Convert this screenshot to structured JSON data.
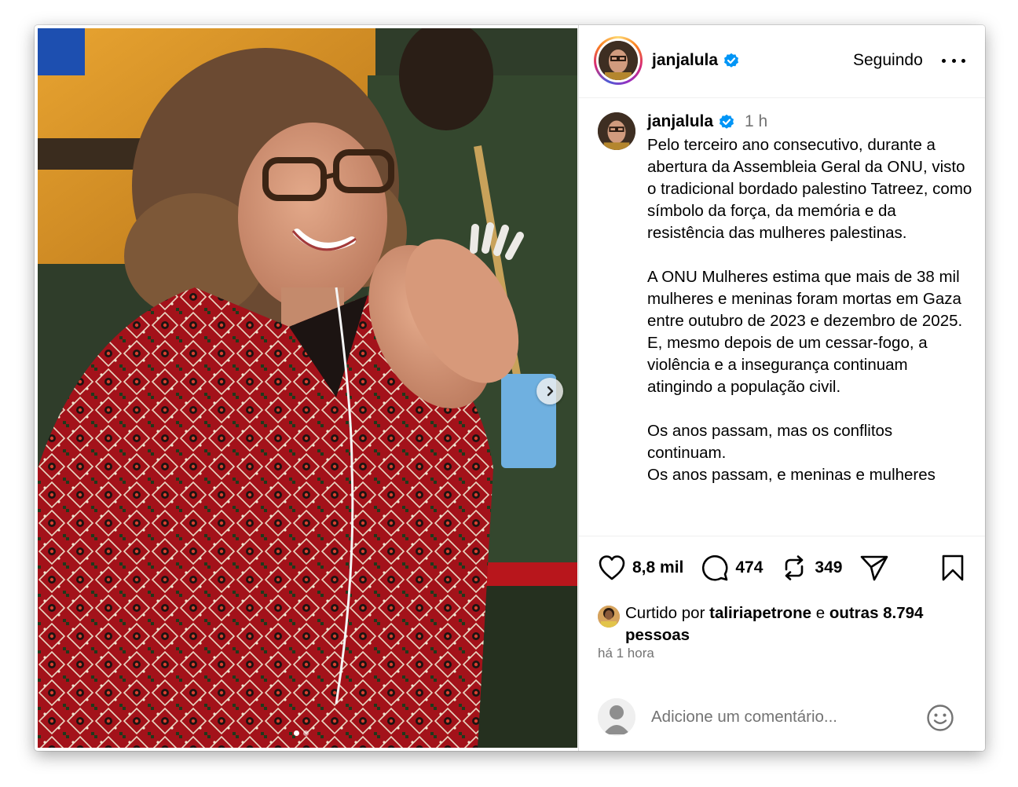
{
  "post": {
    "username": "janjalula",
    "follow_state": "Seguindo",
    "time_short": "1 h",
    "caption": "Pelo terceiro ano consecutivo, durante a abertura da Assembleia Geral da ONU, visto o tradicional bordado palestino Tatreez, como símbolo da força, da memória e da resistência das mulheres palestinas.\n\nA ONU Mulheres estima que mais de 38 mil mulheres e meninas foram mortas em Gaza entre outubro de 2023 e dezembro de 2025. E, mesmo depois de um cessar-fogo, a violência e a insegurança continuam atingindo a população civil.\n\nOs anos passam, mas os conflitos continuam.\nOs anos passam, e meninas e mulheres",
    "carousel": {
      "current": 1,
      "total": 2
    }
  },
  "stats": {
    "likes": "8,8 mil",
    "comments": "474",
    "reposts": "349"
  },
  "liked_by": {
    "prefix": "Curtido por",
    "user": "taliriapetrone",
    "connector": "e",
    "others": "outras 8.794 pessoas"
  },
  "timestamp": "há 1 hora",
  "comment_input": {
    "placeholder": "Adicione um comentário..."
  },
  "icons": {
    "like": "heart-icon",
    "comment": "comment-bubble-icon",
    "repost": "repost-icon",
    "share": "send-icon",
    "save": "bookmark-icon",
    "emoji": "emoji-icon",
    "verified": "verified-badge-icon",
    "more": "more-options-icon",
    "next": "chevron-right-icon"
  },
  "colors": {
    "verified": "#0095f6",
    "muted_text": "#737373",
    "divider": "#efefef",
    "dress_red": "#b5141b"
  }
}
